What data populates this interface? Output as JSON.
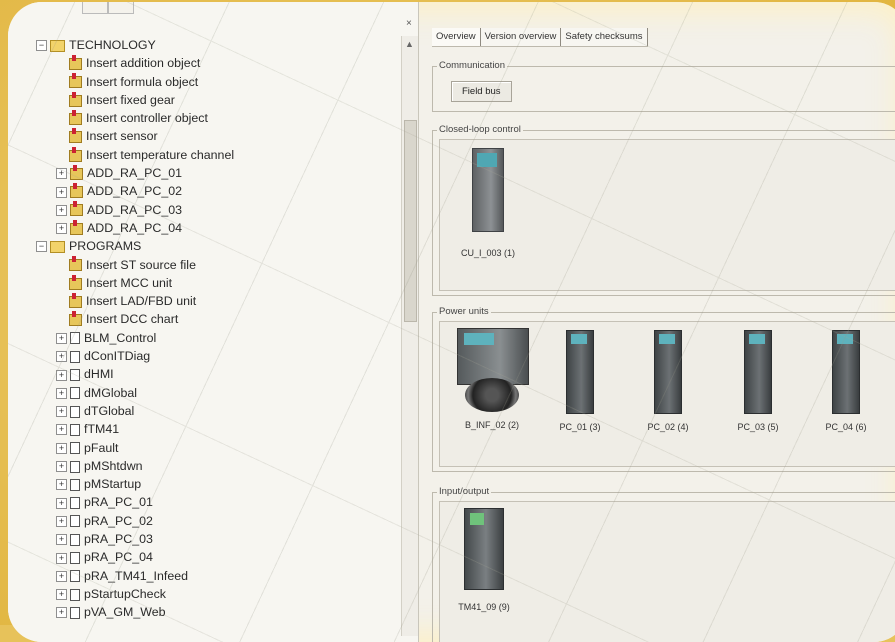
{
  "tree": {
    "rows": [
      {
        "label": "TECHNOLOGY",
        "kind": "folder",
        "level": 0,
        "expander": "−"
      },
      {
        "label": "Insert addition object",
        "kind": "insert",
        "level": 1
      },
      {
        "label": "Insert formula object",
        "kind": "insert",
        "level": 1
      },
      {
        "label": "Insert fixed gear",
        "kind": "insert",
        "level": 1
      },
      {
        "label": "Insert controller object",
        "kind": "insert",
        "level": 1
      },
      {
        "label": "Insert sensor",
        "kind": "insert",
        "level": 1
      },
      {
        "label": "Insert temperature channel",
        "kind": "insert",
        "level": 1
      },
      {
        "label": "ADD_RA_PC_01",
        "kind": "object",
        "level": 1,
        "expander": "+"
      },
      {
        "label": "ADD_RA_PC_02",
        "kind": "object",
        "level": 1,
        "expander": "+"
      },
      {
        "label": "ADD_RA_PC_03",
        "kind": "object",
        "level": 1,
        "expander": "+"
      },
      {
        "label": "ADD_RA_PC_04",
        "kind": "object",
        "level": 1,
        "expander": "+"
      },
      {
        "label": "PROGRAMS",
        "kind": "folder",
        "level": 0,
        "expander": "−"
      },
      {
        "label": "Insert ST source file",
        "kind": "insert",
        "level": 1
      },
      {
        "label": "Insert MCC unit",
        "kind": "insert",
        "level": 1
      },
      {
        "label": "Insert LAD/FBD unit",
        "kind": "insert",
        "level": 1
      },
      {
        "label": "Insert DCC chart",
        "kind": "insert",
        "level": 1
      },
      {
        "label": "BLM_Control",
        "kind": "doc",
        "level": 1,
        "expander": "+"
      },
      {
        "label": "dConITDiag",
        "kind": "doc",
        "level": 1,
        "expander": "+"
      },
      {
        "label": "dHMI",
        "kind": "doc",
        "level": 1,
        "expander": "+"
      },
      {
        "label": "dMGlobal",
        "kind": "doc",
        "level": 1,
        "expander": "+"
      },
      {
        "label": "dTGlobal",
        "kind": "doc",
        "level": 1,
        "expander": "+"
      },
      {
        "label": "fTM41",
        "kind": "doc",
        "level": 1,
        "expander": "+"
      },
      {
        "label": "pFault",
        "kind": "doc",
        "level": 1,
        "expander": "+"
      },
      {
        "label": "pMShtdwn",
        "kind": "doc",
        "level": 1,
        "expander": "+"
      },
      {
        "label": "pMStartup",
        "kind": "doc",
        "level": 1,
        "expander": "+"
      },
      {
        "label": "pRA_PC_01",
        "kind": "doc",
        "level": 1,
        "expander": "+"
      },
      {
        "label": "pRA_PC_02",
        "kind": "doc",
        "level": 1,
        "expander": "+"
      },
      {
        "label": "pRA_PC_03",
        "kind": "doc",
        "level": 1,
        "expander": "+"
      },
      {
        "label": "pRA_PC_04",
        "kind": "doc",
        "level": 1,
        "expander": "+"
      },
      {
        "label": "pRA_TM41_Infeed",
        "kind": "doc",
        "level": 1,
        "expander": "+"
      },
      {
        "label": "pStartupCheck",
        "kind": "doc",
        "level": 1,
        "expander": "+"
      },
      {
        "label": "pVA_GM_Web",
        "kind": "doc",
        "level": 1,
        "expander": "+"
      }
    ]
  },
  "tabs": [
    "Overview",
    "Version overview",
    "Safety checksums"
  ],
  "communication": {
    "legend": "Communication",
    "button": "Field bus"
  },
  "closed_loop": {
    "legend": "Closed-loop control",
    "devices": [
      {
        "label": "CU_I_003 (1)"
      }
    ]
  },
  "power_units": {
    "legend": "Power units",
    "devices": [
      {
        "label": "B_INF_02 (2)",
        "type": "big"
      },
      {
        "label": "PC_01 (3)",
        "type": "small"
      },
      {
        "label": "PC_02 (4)",
        "type": "small"
      },
      {
        "label": "PC_03 (5)",
        "type": "small"
      },
      {
        "label": "PC_04 (6)",
        "type": "small"
      }
    ]
  },
  "io": {
    "legend": "Input/output",
    "devices": [
      {
        "label": "TM41_09 (9)"
      }
    ]
  },
  "icons": {
    "close": "×",
    "scroll_up": "▲"
  }
}
